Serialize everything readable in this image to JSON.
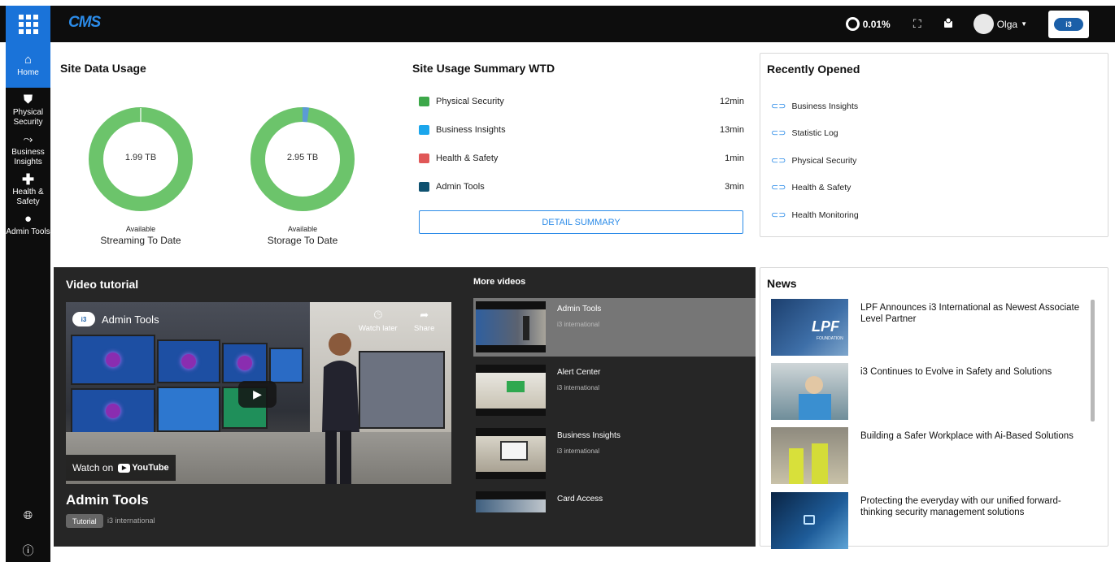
{
  "header": {
    "app_logo": "CMS",
    "usage_percent": "0.01%",
    "user_name": "Olga",
    "icons": [
      "apps-grid-icon",
      "usage-ring-icon",
      "fullscreen-icon",
      "notification-icon",
      "user-avatar-icon",
      "brand-logo"
    ]
  },
  "sidebar": {
    "items": [
      {
        "label": "Home",
        "icon": "home-icon"
      },
      {
        "label": "Physical Security",
        "icon": "shield-icon"
      },
      {
        "label": "Business Insights",
        "icon": "chart-icon"
      },
      {
        "label": "Health & Safety",
        "icon": "plus-icon"
      },
      {
        "label": "Admin Tools",
        "icon": "user-circle-icon"
      }
    ],
    "bottom_icons": [
      "globe-icon",
      "info-icon"
    ]
  },
  "site_data_usage": {
    "title": "Site Data Usage",
    "donuts": [
      {
        "value": "1.99 TB",
        "sub": "Available",
        "name": "Streaming To Date",
        "used_fraction": 0.0
      },
      {
        "value": "2.95 TB",
        "sub": "Available",
        "name": "Storage To Date",
        "used_fraction": 0.02
      }
    ],
    "colors": {
      "available": "#6cc46b",
      "used": "#5b9bd5"
    }
  },
  "usage_summary": {
    "title": "Site Usage Summary WTD",
    "rows": [
      {
        "label": "Physical Security",
        "value": "12min",
        "color": "#3da84a"
      },
      {
        "label": "Business Insights",
        "value": "13min",
        "color": "#1ba6ec"
      },
      {
        "label": "Health & Safety",
        "value": "1min",
        "color": "#e05757"
      },
      {
        "label": "Admin Tools",
        "value": "3min",
        "color": "#0f5170"
      }
    ],
    "button": "DETAIL SUMMARY"
  },
  "recently_opened": {
    "title": "Recently Opened",
    "items": [
      "Business Insights",
      "Statistic Log",
      "Physical Security",
      "Health & Safety",
      "Health Monitoring"
    ]
  },
  "video_tutorial": {
    "title": "Video tutorial",
    "player": {
      "channel": "Admin Tools",
      "watch_later": "Watch later",
      "share": "Share",
      "watch_on": "Watch on",
      "youtube": "YouTube"
    },
    "video_name": "Admin Tools",
    "tag": "Tutorial",
    "author": "i3 international"
  },
  "more_videos": {
    "title": "More videos",
    "items": [
      {
        "title": "Admin Tools",
        "author": "i3 international",
        "active": true
      },
      {
        "title": "Alert Center",
        "author": "i3 international",
        "active": false
      },
      {
        "title": "Business Insights",
        "author": "i3 international",
        "active": false
      },
      {
        "title": "Card Access",
        "author": "",
        "active": false
      }
    ]
  },
  "news": {
    "title": "News",
    "items": [
      {
        "title": "LPF Announces i3 International as Newest Associate Level Partner",
        "image_text": "LPF",
        "image_sub": "FOUNDATION"
      },
      {
        "title": "i3 Continues to Evolve in Safety and Solutions"
      },
      {
        "title": "Building a Safer Workplace with Ai-Based Solutions"
      },
      {
        "title": "Protecting the everyday with our unified forward-thinking security management solutions"
      }
    ]
  }
}
